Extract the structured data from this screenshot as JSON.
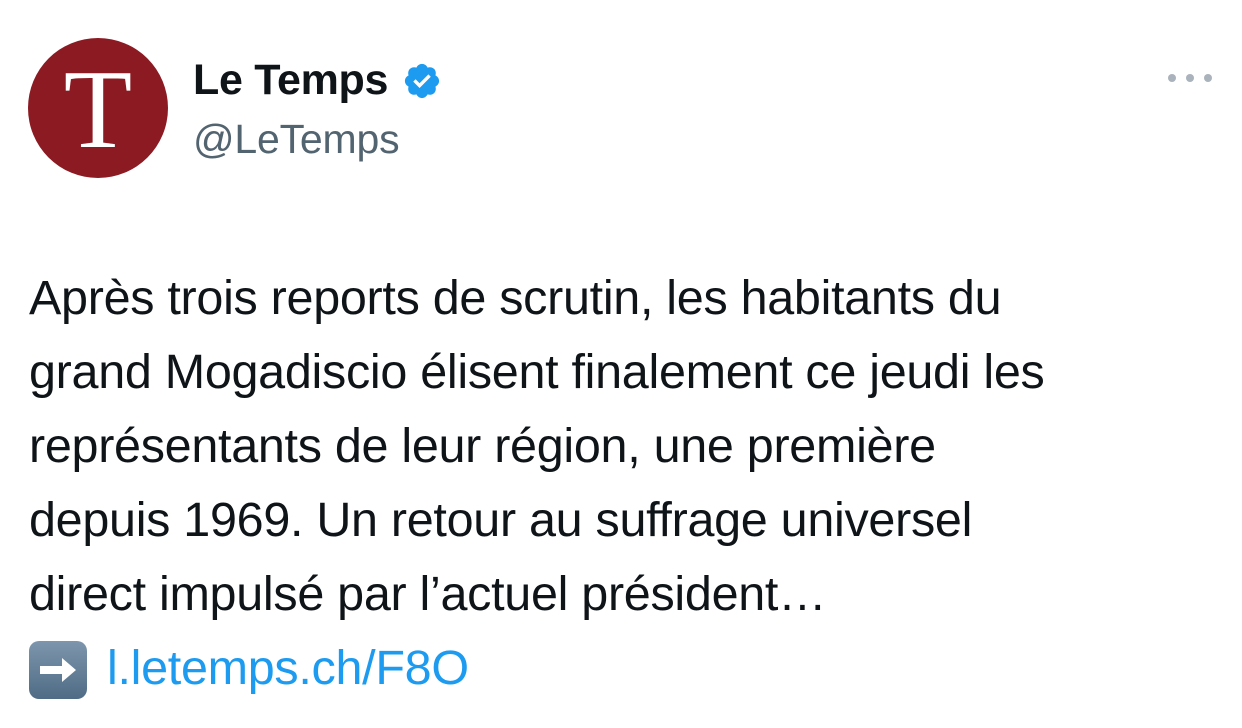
{
  "author": {
    "display_name": "Le Temps",
    "handle": "@LeTemps",
    "avatar_letter": "T",
    "avatar_color": "#8b1a22",
    "verified": true,
    "verified_color": "#1d9bf0"
  },
  "tweet": {
    "lines": [
      "Après trois reports de scrutin, les habitants du",
      "grand Mogadiscio élisent finalement ce jeudi les",
      "représentants de leur région, une première",
      "depuis 1969. Un retour au suffrage universel",
      "direct impulsé par l’actuel président…"
    ],
    "link_emoji": "arrow-right-emoji",
    "link_text": "l.letemps.ch/F8O"
  },
  "colors": {
    "text": "#0f1419",
    "secondary": "#536471",
    "link": "#1d9bf0"
  }
}
